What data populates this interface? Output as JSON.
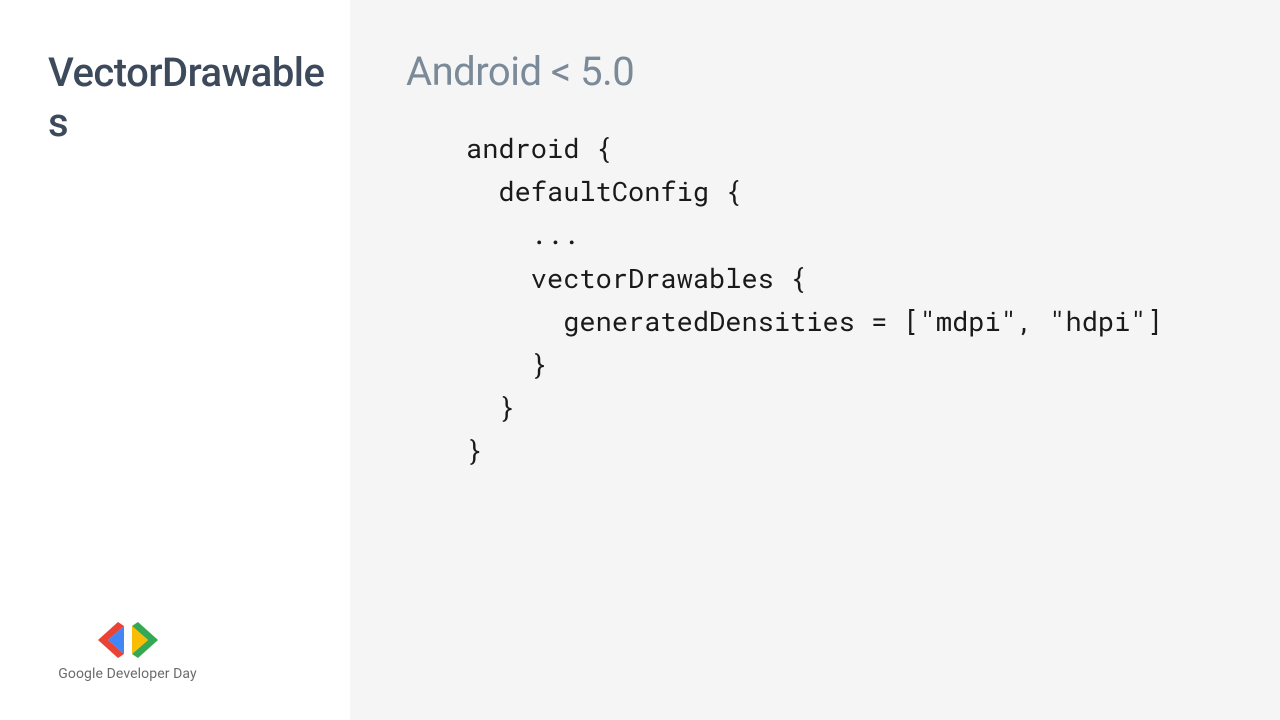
{
  "sidebar": {
    "title": "VectorDrawables"
  },
  "content": {
    "heading": "Android < 5.0",
    "code": "android {\n  defaultConfig {\n    ...\n    vectorDrawables {\n      generatedDensities = [\"mdpi\", \"hdpi\"]\n    }\n  }\n}"
  },
  "footer": {
    "brand_part1": "Google ",
    "brand_part2": "Developer Day"
  }
}
